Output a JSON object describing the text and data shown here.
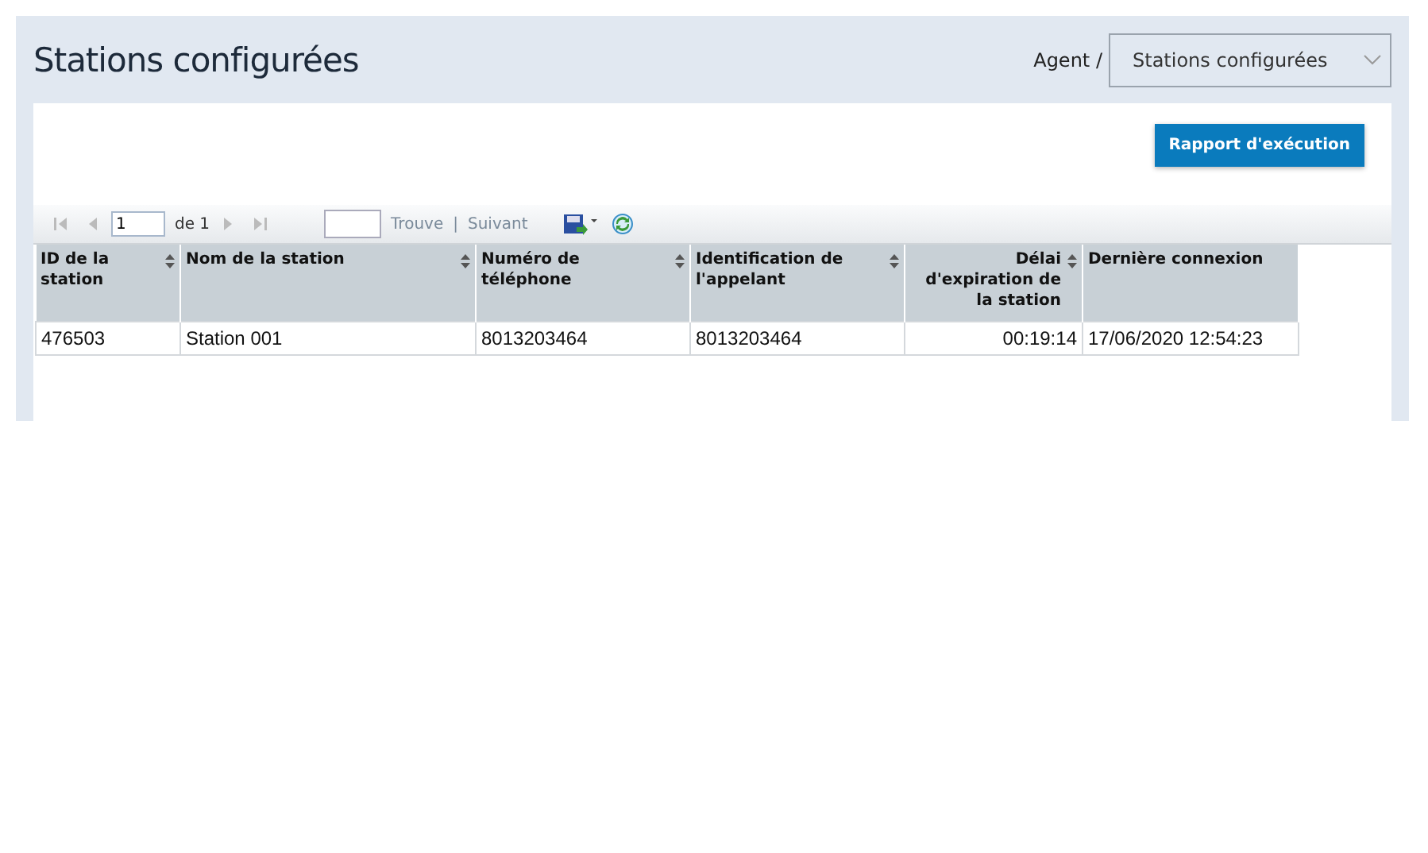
{
  "page_title": "Stations configurées",
  "breadcrumb": "Agent /",
  "view_select": {
    "value": "Stations configurées"
  },
  "report_button": "Rapport d'exécution",
  "toolbar": {
    "page_value": "1",
    "page_total": "de 1",
    "find_label": "Trouve",
    "separator": "|",
    "next_label": "Suivant"
  },
  "table": {
    "columns": [
      {
        "label": "ID de la station",
        "sortable": true,
        "kind": "text"
      },
      {
        "label": "Nom de la station",
        "sortable": true,
        "kind": "text"
      },
      {
        "label": "Numéro de téléphone",
        "sortable": true,
        "kind": "text"
      },
      {
        "label": "Identification de l'appelant",
        "sortable": true,
        "kind": "text"
      },
      {
        "label": "Délai d'expiration de la station",
        "sortable": true,
        "kind": "duration"
      },
      {
        "label": "Dernière connexion",
        "sortable": false,
        "kind": "text"
      }
    ],
    "rows": [
      [
        "476503",
        "Station 001",
        "8013203464",
        "8013203464",
        "00:19:14",
        "17/06/2020 12:54:23"
      ]
    ]
  }
}
